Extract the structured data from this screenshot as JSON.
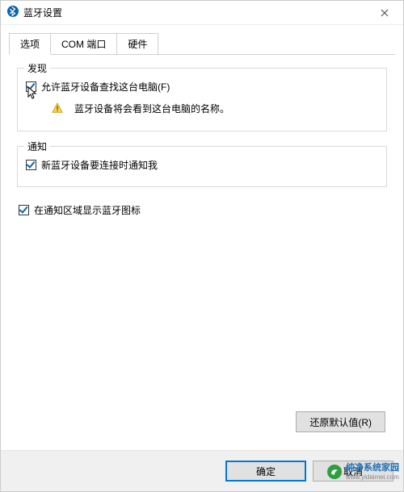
{
  "window": {
    "title": "蓝牙设置"
  },
  "tabs": {
    "options": "选项",
    "com": "COM 端口",
    "hardware": "硬件"
  },
  "group_discovery": {
    "title": "发现",
    "allow_label": "允许蓝牙设备查找这台电脑(F)",
    "allow_checked": true,
    "warn_text": "蓝牙设备将会看到这台电脑的名称。"
  },
  "group_notify": {
    "title": "通知",
    "notify_label": "新蓝牙设备要连接时通知我",
    "notify_checked": true
  },
  "tray": {
    "show_icon_label": "在通知区域显示蓝牙图标",
    "show_icon_checked": true
  },
  "buttons": {
    "restore": "还原默认值(R)",
    "ok": "确定",
    "cancel": "取消"
  },
  "watermark": {
    "line1": "纯净系统家园",
    "line2": "www.yidaimei.com"
  }
}
